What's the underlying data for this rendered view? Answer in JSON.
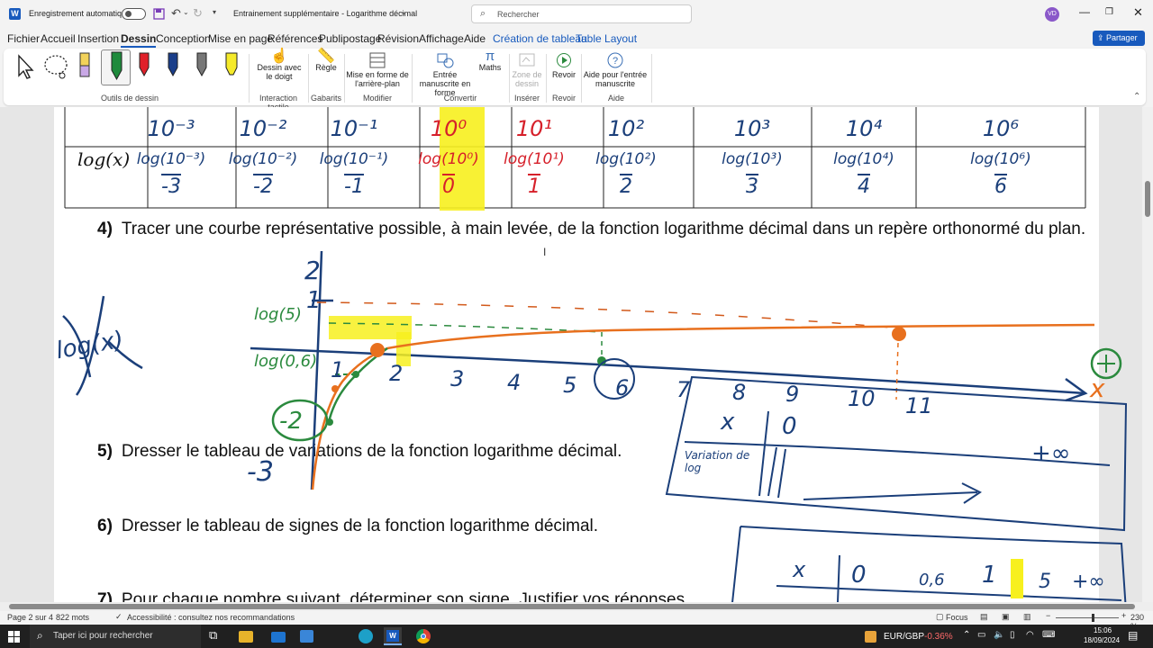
{
  "titlebar": {
    "autosave_label": "Enregistrement automatique",
    "doc_title": "Entrainement supplémentaire - Logarithme décimal",
    "search_placeholder": "Rechercher",
    "avatar_initials": "VD"
  },
  "ribbon_tabs": [
    "Fichier",
    "Accueil",
    "Insertion",
    "Dessin",
    "Conception",
    "Mise en page",
    "Références",
    "Publipostage",
    "Révision",
    "Affichage",
    "Aide",
    "Création de tableau",
    "Table Layout"
  ],
  "share_label": "Partager",
  "ribbon": {
    "groups": {
      "tools": "Outils de dessin",
      "touch": "Interaction tactile",
      "stencils": "Gabarits",
      "modify": "Modifier",
      "convert": "Convertir",
      "insert": "Insérer",
      "replay": "Revoir",
      "help": "Aide"
    },
    "buttons": {
      "draw_finger": "Dessin avec le doigt",
      "ruler": "Règle",
      "background": "Mise en forme de l'arrière-plan",
      "ink_shape": "Entrée manuscrite en forme",
      "math": "Maths",
      "drawing_zone": "Zone de dessin",
      "replay": "Revoir",
      "ink_help": "Aide pour l'entrée manuscrite"
    }
  },
  "document": {
    "table_header_label": "log(x)",
    "table_top_row": [
      "10⁻³",
      "10⁻²",
      "10⁻¹",
      "10⁰",
      "10¹",
      "10²",
      "10³",
      "10⁴",
      "10⁶"
    ],
    "table_log_row": [
      "log(10⁻³)",
      "log(10⁻²)",
      "log(10⁻¹)",
      "log(10⁰)",
      "log(10¹)",
      "log(10²)",
      "log(10³)",
      "log(10⁴)",
      "log(10⁶)"
    ],
    "table_result_row": [
      "-3",
      "-2",
      "-1",
      "0",
      "1",
      "2",
      "3",
      "4",
      "6"
    ],
    "questions": [
      {
        "num": "4)",
        "text": "Tracer une courbe représentative possible, à main levée, de la fonction logarithme décimal dans un repère orthonormé du plan."
      },
      {
        "num": "5)",
        "text": "Dresser le tableau de variations de la fonction logarithme décimal."
      },
      {
        "num": "6)",
        "text": "Dresser le tableau de signes de la fonction logarithme décimal."
      },
      {
        "num": "7)",
        "text": "Pour chaque nombre suivant, déterminer son signe. Justifier vos réponses."
      }
    ],
    "handwriting": {
      "side_label": "log(x)",
      "y_ticks": [
        "2",
        "1",
        "-3"
      ],
      "x_ticks": [
        "1",
        "2",
        "3",
        "4",
        "5",
        "6",
        "7",
        "8",
        "9",
        "10",
        "11"
      ],
      "log5": "log(5)",
      "log06": "log(0,6)",
      "minus2": "-2",
      "x_axis": "x",
      "var_table": {
        "x": "x",
        "zero": "0",
        "infinity": "+∞",
        "row_label": "Variation de log"
      },
      "sign_table": {
        "x": "x",
        "values": [
          "0",
          "0,6",
          "1",
          "5",
          "+∞"
        ]
      }
    }
  },
  "status": {
    "page": "Page 2 sur 4",
    "words": "822 mots",
    "accessibility": "Accessibilité : consultez nos recommandations",
    "focus": "Focus",
    "zoom": "230 %"
  },
  "taskbar": {
    "search_placeholder": "Taper ici pour rechercher",
    "ticker_name": "EUR/GBP",
    "ticker_change": "-0.36%",
    "time": "15:06",
    "date": "18/09/2024"
  }
}
